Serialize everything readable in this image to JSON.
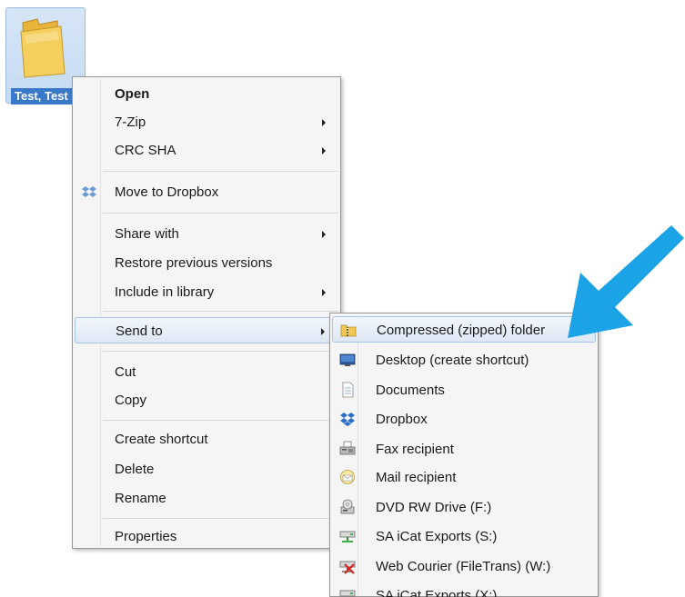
{
  "desktop": {
    "folder": {
      "label": "Test, Test",
      "icon": "folder-icon"
    }
  },
  "context_menu": {
    "items": [
      {
        "label": "Open",
        "bold": true,
        "icon": null,
        "submenu": false
      },
      {
        "label": "7-Zip",
        "bold": false,
        "icon": null,
        "submenu": true
      },
      {
        "label": "CRC SHA",
        "bold": false,
        "icon": null,
        "submenu": true
      },
      {
        "label": "Move to Dropbox",
        "bold": false,
        "icon": "dropbox-icon",
        "submenu": false
      },
      {
        "label": "Share with",
        "bold": false,
        "icon": null,
        "submenu": true
      },
      {
        "label": "Restore previous versions",
        "bold": false,
        "icon": null,
        "submenu": false
      },
      {
        "label": "Include in library",
        "bold": false,
        "icon": null,
        "submenu": true
      },
      {
        "label": "Send to",
        "bold": false,
        "icon": null,
        "submenu": true,
        "highlighted": true
      },
      {
        "label": "Cut",
        "bold": false,
        "icon": null,
        "submenu": false
      },
      {
        "label": "Copy",
        "bold": false,
        "icon": null,
        "submenu": false
      },
      {
        "label": "Create shortcut",
        "bold": false,
        "icon": null,
        "submenu": false
      },
      {
        "label": "Delete",
        "bold": false,
        "icon": null,
        "submenu": false
      },
      {
        "label": "Rename",
        "bold": false,
        "icon": null,
        "submenu": false
      },
      {
        "label": "Properties",
        "bold": false,
        "icon": null,
        "submenu": false
      }
    ]
  },
  "send_to_menu": {
    "items": [
      {
        "label": "Compressed (zipped) folder",
        "icon": "zip-folder-icon",
        "highlighted": true
      },
      {
        "label": "Desktop (create shortcut)",
        "icon": "desktop-icon"
      },
      {
        "label": "Documents",
        "icon": "documents-icon"
      },
      {
        "label": "Dropbox",
        "icon": "dropbox-icon"
      },
      {
        "label": "Fax recipient",
        "icon": "fax-icon"
      },
      {
        "label": "Mail recipient",
        "icon": "mail-icon"
      },
      {
        "label": "DVD RW Drive (F:)",
        "icon": "dvd-drive-icon"
      },
      {
        "label": "SA iCat Exports (S:)",
        "icon": "network-drive-icon"
      },
      {
        "label": "Web Courier (FileTrans) (W:)",
        "icon": "disconnected-drive-icon"
      },
      {
        "label": "SA iCat Exports (X:)",
        "icon": "network-drive-icon"
      }
    ]
  },
  "annotation": {
    "arrow_color": "#1aa3e6",
    "icon": "pointer-arrow-icon"
  },
  "colors": {
    "menu_bg": "#f5f5f5",
    "highlight_border": "#a8c4e8",
    "selection_blue": "#3a78c8"
  }
}
